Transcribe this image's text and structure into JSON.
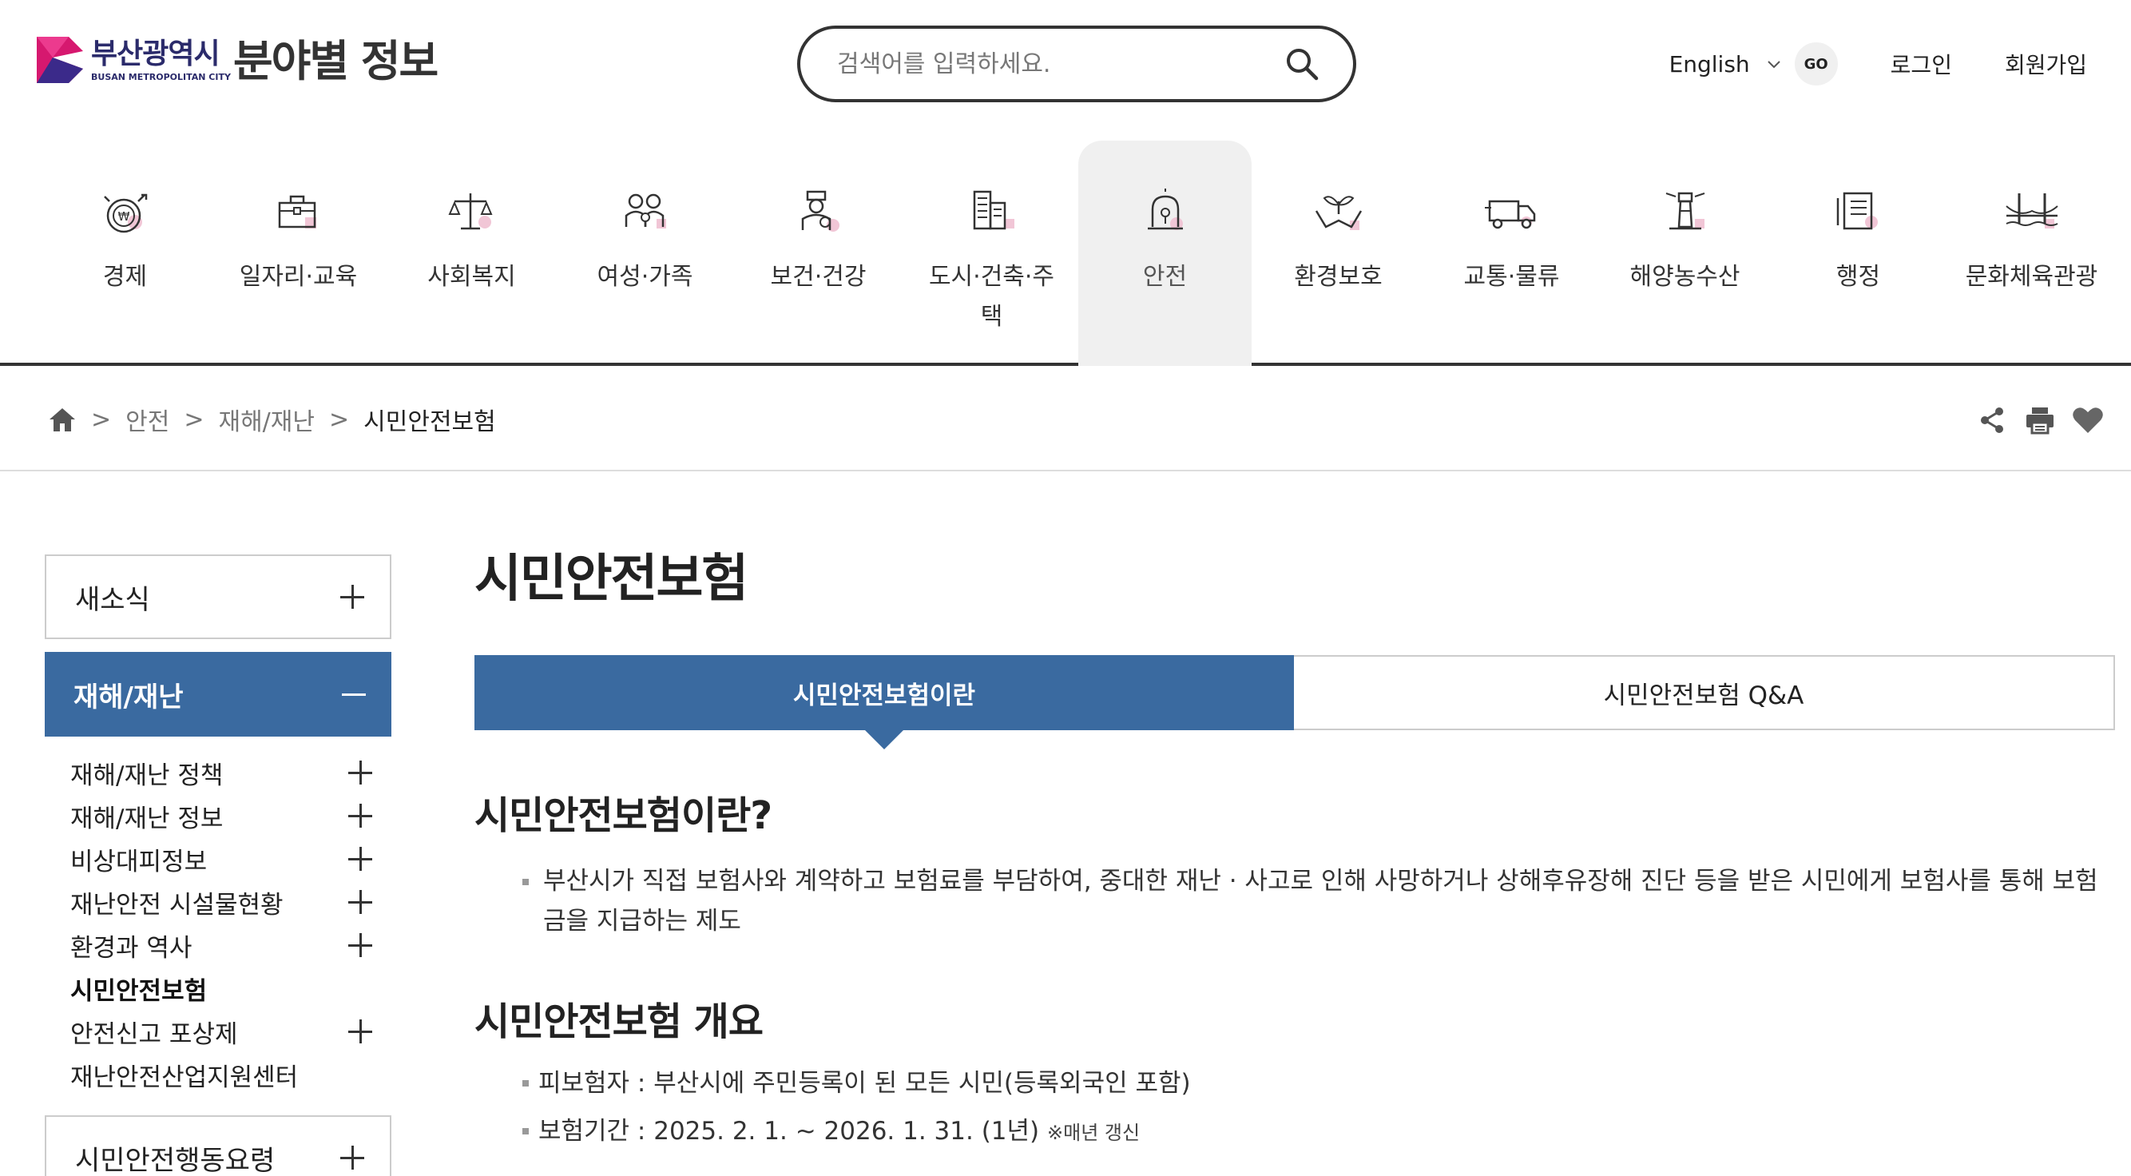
{
  "header": {
    "logo_kr": "부산광역시",
    "logo_en": "BUSAN METROPOLITAN CITY",
    "site_title": "분야별 정보",
    "search_placeholder": "검색어를 입력하세요.",
    "language": "English",
    "go": "GO",
    "login": "로그인",
    "signup": "회원가입"
  },
  "gnb": {
    "items": [
      {
        "label": "경제",
        "icon": "economy-coin-icon"
      },
      {
        "label": "일자리·교육",
        "icon": "briefcase-icon"
      },
      {
        "label": "사회복지",
        "icon": "scale-icon"
      },
      {
        "label": "여성·가족",
        "icon": "family-icon"
      },
      {
        "label": "보건·건강",
        "icon": "doctor-icon"
      },
      {
        "label": "도시·건축·주택",
        "icon": "building-icon"
      },
      {
        "label": "안전",
        "icon": "siren-icon"
      },
      {
        "label": "환경보호",
        "icon": "plant-hand-icon"
      },
      {
        "label": "교통·물류",
        "icon": "truck-icon"
      },
      {
        "label": "해양농수산",
        "icon": "lighthouse-icon"
      },
      {
        "label": "행정",
        "icon": "document-icon"
      },
      {
        "label": "문화체육관광",
        "icon": "bridge-icon"
      }
    ],
    "active_index": 6
  },
  "breadcrumb": {
    "home_icon": "home-icon",
    "items": [
      "안전",
      "재해/재난",
      "시민안전보험"
    ],
    "sep": ">"
  },
  "lnb": {
    "top": "새소식",
    "active": "재해/재난",
    "sub": [
      {
        "label": "재해/재난 정책",
        "plus": true
      },
      {
        "label": "재해/재난 정보",
        "plus": true
      },
      {
        "label": "비상대피정보",
        "plus": true
      },
      {
        "label": "재난안전 시설물현황",
        "plus": true
      },
      {
        "label": "환경과 역사",
        "plus": true
      },
      {
        "label": "시민안전보험",
        "plus": false,
        "on": true
      },
      {
        "label": "안전신고 포상제",
        "plus": true
      },
      {
        "label": "재난안전산업지원센터",
        "plus": false
      }
    ],
    "bottom": "시민안전행동요령"
  },
  "content": {
    "title": "시민안전보험",
    "tabs": [
      "시민안전보험이란",
      "시민안전보험 Q&A"
    ],
    "section1_title": "시민안전보험이란?",
    "section1_text": "부산시가 직접 보험사와 계약하고 보험료를 부담하여, 중대한 재난 · 사고로 인해 사망하거나 상해후유장해 진단 등을 받은 시민에게 보험사를 통해 보험금을 지급하는 제도",
    "section2_title": "시민안전보험 개요",
    "section2_items": [
      "피보험자 : 부산시에 주민등록이 된 모든 시민(등록외국인 포함)",
      "보험기간 : 2025. 2. 1. ~ 2026. 1. 31. (1년)"
    ],
    "section2_note": "※매년 갱신"
  }
}
